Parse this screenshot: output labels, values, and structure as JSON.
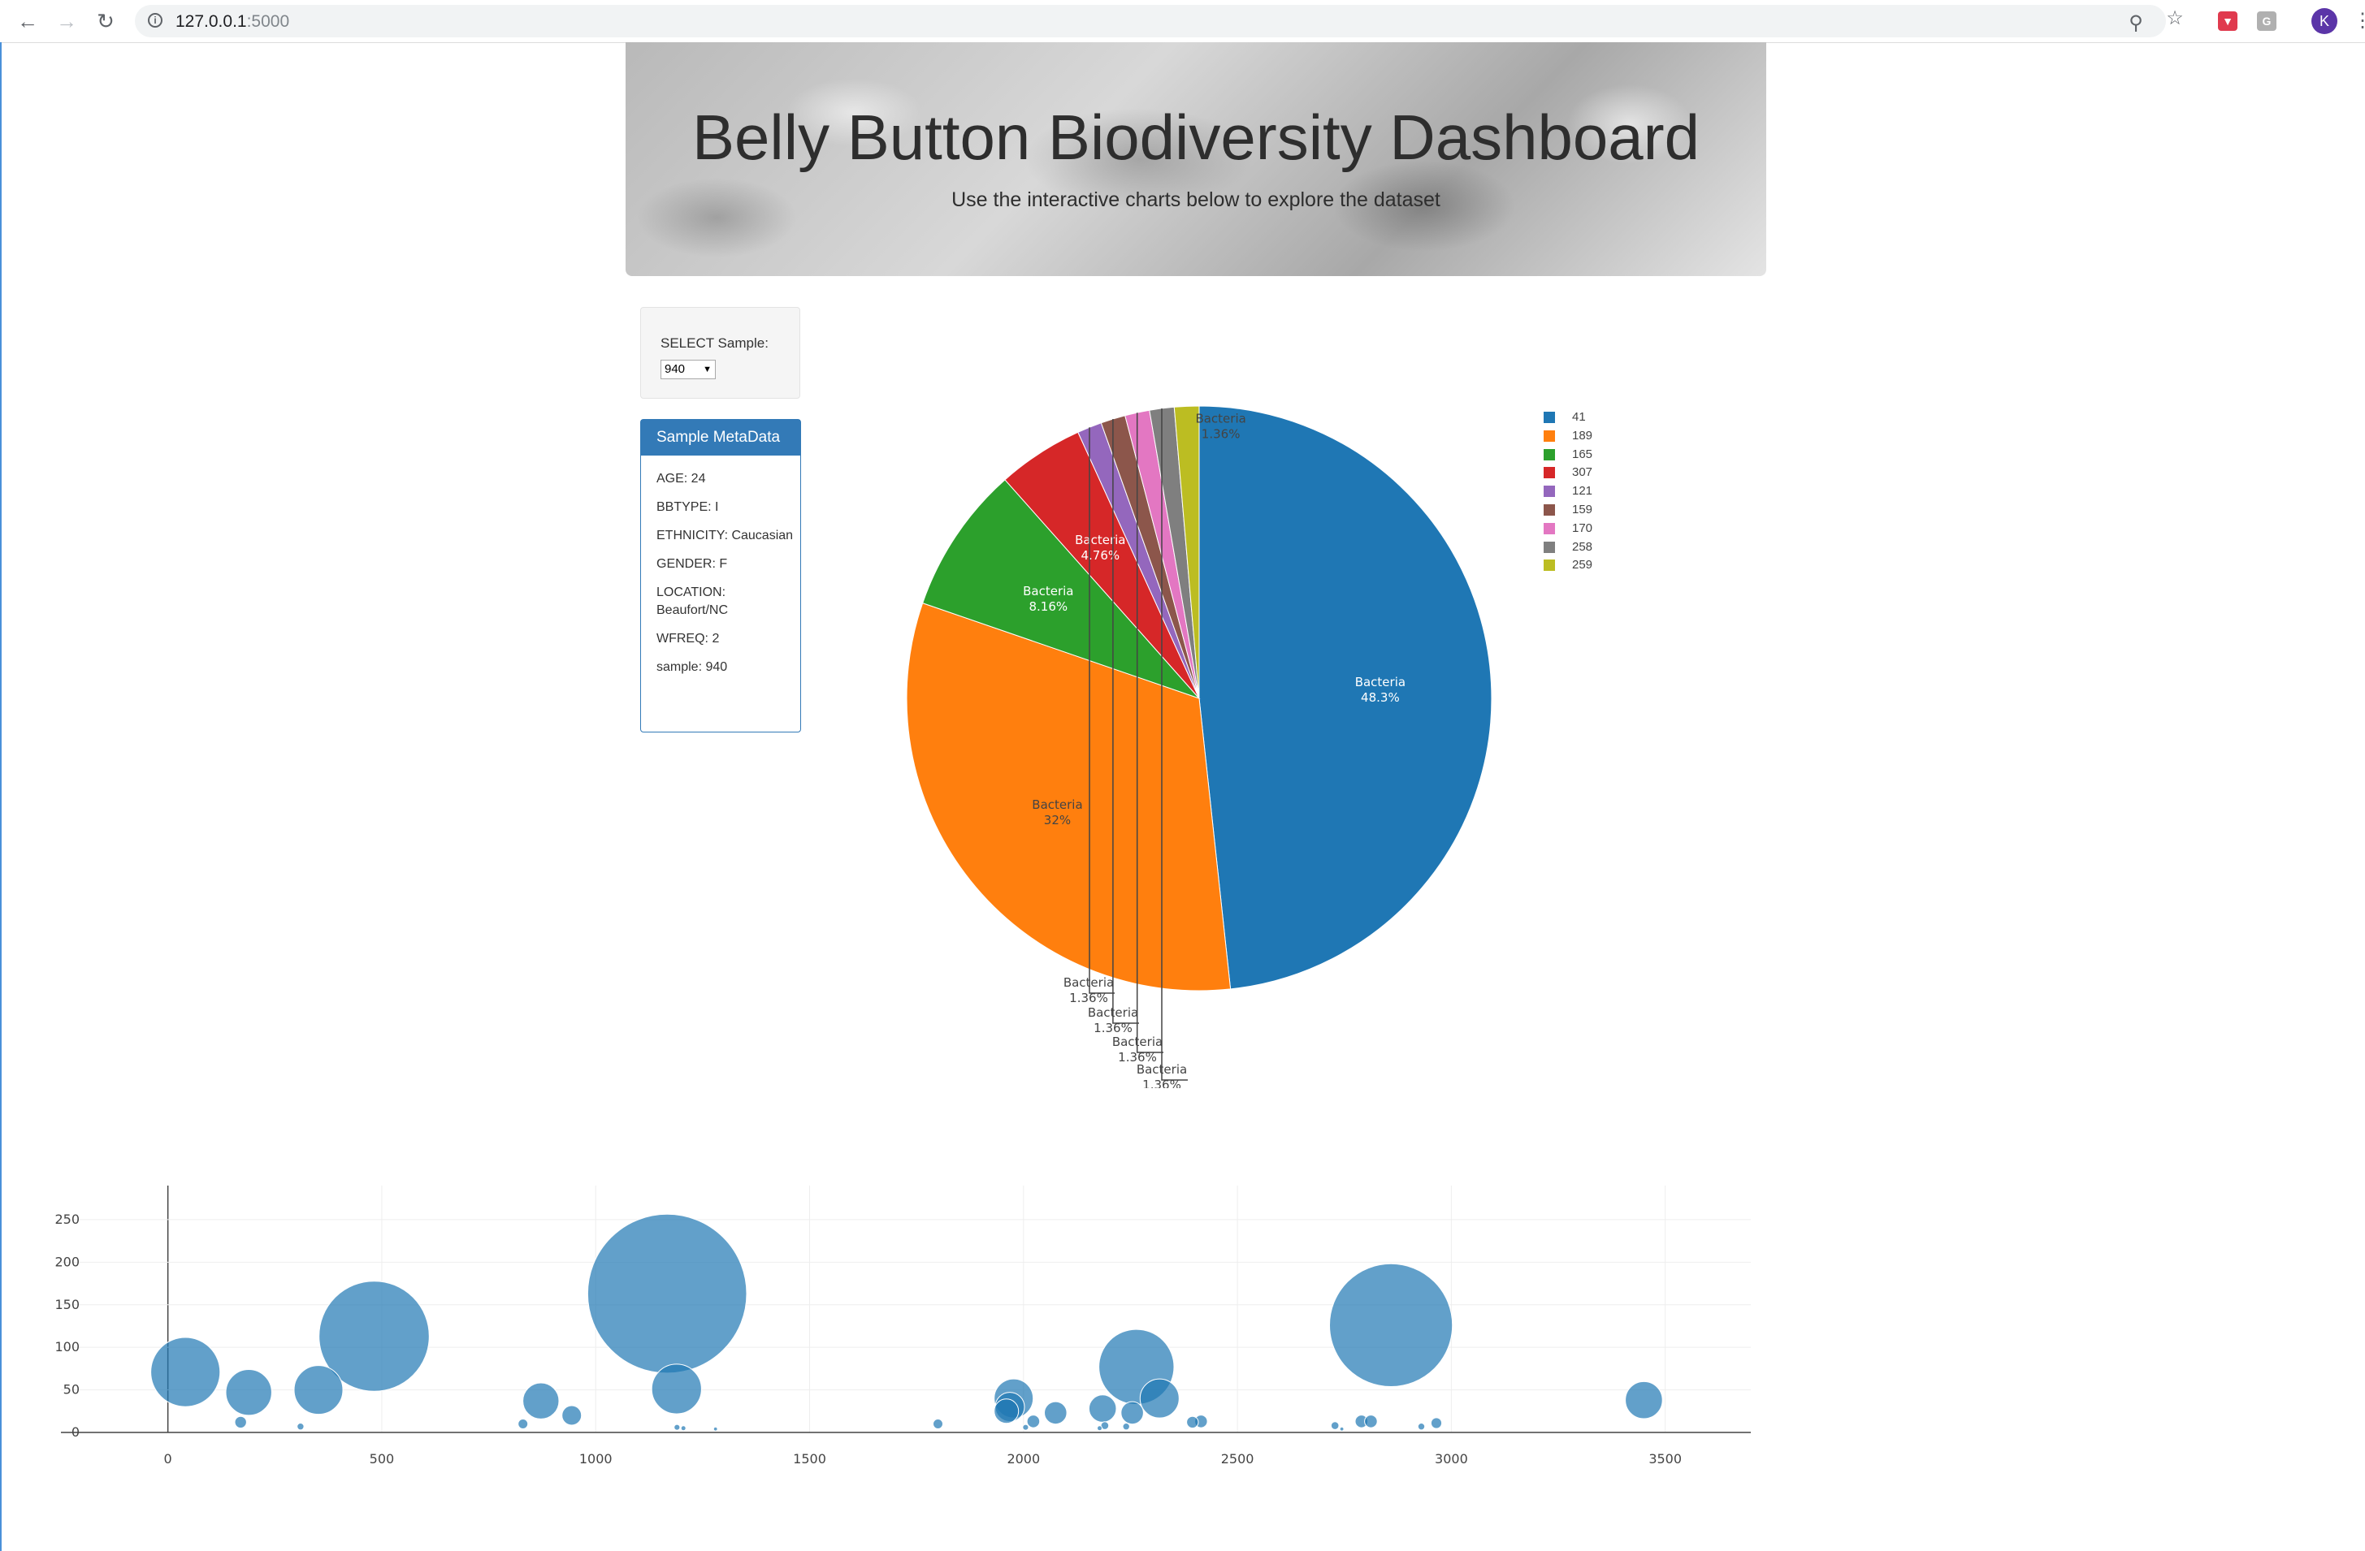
{
  "browser": {
    "url_host": "127.0.0.1",
    "url_port": ":5000",
    "profile_initial": "K",
    "ext_badge": "G"
  },
  "header": {
    "title": "Belly Button Biodiversity Dashboard",
    "subtitle": "Use the interactive charts below to explore the dataset"
  },
  "selector": {
    "label": "SELECT Sample:",
    "value": "940"
  },
  "metadata": {
    "title": "Sample MetaData",
    "items": [
      "AGE: 24",
      "BBTYPE: I",
      "ETHNICITY: Caucasian",
      "GENDER: F",
      "LOCATION: Beaufort/NC",
      "WFREQ: 2",
      "sample: 940"
    ]
  },
  "colors": {
    "accent": "#337ab7",
    "pie": [
      "#1f77b4",
      "#ff7f0e",
      "#2ca02c",
      "#d62728",
      "#9467bd",
      "#8c564b",
      "#e377c2",
      "#7f7f7f",
      "#bcbd22"
    ],
    "bubble": "#1f77b4"
  },
  "chart_data": [
    {
      "type": "pie",
      "categories": [
        "41",
        "189",
        "165",
        "307",
        "121",
        "159",
        "170",
        "258",
        "259"
      ],
      "values": [
        48.3,
        32,
        8.16,
        4.76,
        1.36,
        1.36,
        1.36,
        1.36,
        1.36
      ],
      "slice_labels": [
        "Bacteria",
        "Bacteria",
        "Bacteria",
        "Bacteria",
        "Bacteria",
        "Bacteria",
        "Bacteria",
        "Bacteria",
        "Bacteria"
      ],
      "percent_labels": [
        "48.3%",
        "32%",
        "8.16%",
        "4.76%",
        "1.36%",
        "1.36%",
        "1.36%",
        "1.36%",
        "1.36%"
      ],
      "legend": "top-right"
    },
    {
      "type": "scatter",
      "xlim": [
        -250,
        3700
      ],
      "ylim": [
        0,
        290
      ],
      "xticks": [
        "0",
        "500",
        "1000",
        "1500",
        "2000",
        "2500",
        "3000",
        "3500"
      ],
      "yticks": [
        "0",
        "50",
        "100",
        "150",
        "200",
        "250"
      ],
      "grid": true,
      "points": [
        {
          "x": 41,
          "y": 71,
          "size": 71
        },
        {
          "x": 189,
          "y": 47,
          "size": 47
        },
        {
          "x": 352,
          "y": 50,
          "size": 50
        },
        {
          "x": 482,
          "y": 113,
          "size": 113
        },
        {
          "x": 872,
          "y": 37,
          "size": 37
        },
        {
          "x": 1167,
          "y": 163,
          "size": 163
        },
        {
          "x": 1189,
          "y": 51,
          "size": 51
        },
        {
          "x": 944,
          "y": 20,
          "size": 20
        },
        {
          "x": 1977,
          "y": 40,
          "size": 40
        },
        {
          "x": 1960,
          "y": 25,
          "size": 25
        },
        {
          "x": 1968,
          "y": 30,
          "size": 30
        },
        {
          "x": 2075,
          "y": 23,
          "size": 23
        },
        {
          "x": 2264,
          "y": 77,
          "size": 77
        },
        {
          "x": 2318,
          "y": 40,
          "size": 40
        },
        {
          "x": 2185,
          "y": 28,
          "size": 28
        },
        {
          "x": 2254,
          "y": 23,
          "size": 23
        },
        {
          "x": 2859,
          "y": 126,
          "size": 126
        },
        {
          "x": 3450,
          "y": 38,
          "size": 38
        },
        {
          "x": 170,
          "y": 12,
          "size": 12
        },
        {
          "x": 830,
          "y": 10,
          "size": 10
        },
        {
          "x": 1800,
          "y": 10,
          "size": 10
        },
        {
          "x": 2023,
          "y": 13,
          "size": 13
        },
        {
          "x": 2395,
          "y": 12,
          "size": 12
        },
        {
          "x": 2415,
          "y": 13,
          "size": 13
        },
        {
          "x": 2790,
          "y": 13,
          "size": 13
        },
        {
          "x": 2812,
          "y": 13,
          "size": 13
        },
        {
          "x": 2965,
          "y": 11,
          "size": 11
        },
        {
          "x": 2728,
          "y": 8,
          "size": 8
        },
        {
          "x": 2930,
          "y": 7,
          "size": 7
        },
        {
          "x": 310,
          "y": 7,
          "size": 7
        },
        {
          "x": 1190,
          "y": 6,
          "size": 6
        },
        {
          "x": 1205,
          "y": 5,
          "size": 5
        },
        {
          "x": 2190,
          "y": 8,
          "size": 8
        },
        {
          "x": 2240,
          "y": 7,
          "size": 7
        },
        {
          "x": 2005,
          "y": 6,
          "size": 6
        },
        {
          "x": 1280,
          "y": 4,
          "size": 4
        },
        {
          "x": 2178,
          "y": 5,
          "size": 5
        },
        {
          "x": 2744,
          "y": 4,
          "size": 4
        }
      ]
    }
  ]
}
